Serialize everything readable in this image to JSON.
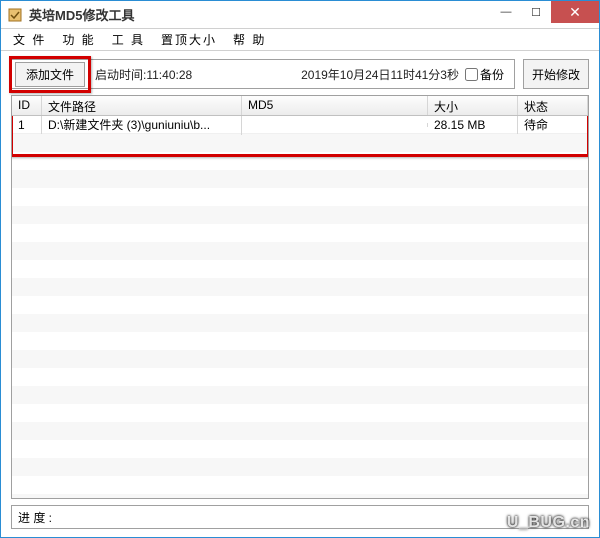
{
  "window": {
    "title": "英培MD5修改工具"
  },
  "menu": {
    "file": "文 件",
    "function": "功 能",
    "tool": "工 具",
    "topsize": "置顶大小",
    "help": "帮 助"
  },
  "toolbar": {
    "add_file": "添加文件",
    "start_time_label": "启动时间:11:40:28",
    "current_time": "2019年10月24日11时41分3秒",
    "backup_label": "备份",
    "start_modify": "开始修改"
  },
  "columns": {
    "id": "ID",
    "path": "文件路径",
    "md5": "MD5",
    "size": "大小",
    "status": "状态"
  },
  "rows": [
    {
      "id": "1",
      "path": "D:\\新建文件夹 (3)\\guniuniu\\b...",
      "md5": "",
      "size": "28.15 MB",
      "status": "待命"
    }
  ],
  "footer": {
    "progress_label": "进 度 :"
  },
  "watermark": "U_BUG.cn"
}
